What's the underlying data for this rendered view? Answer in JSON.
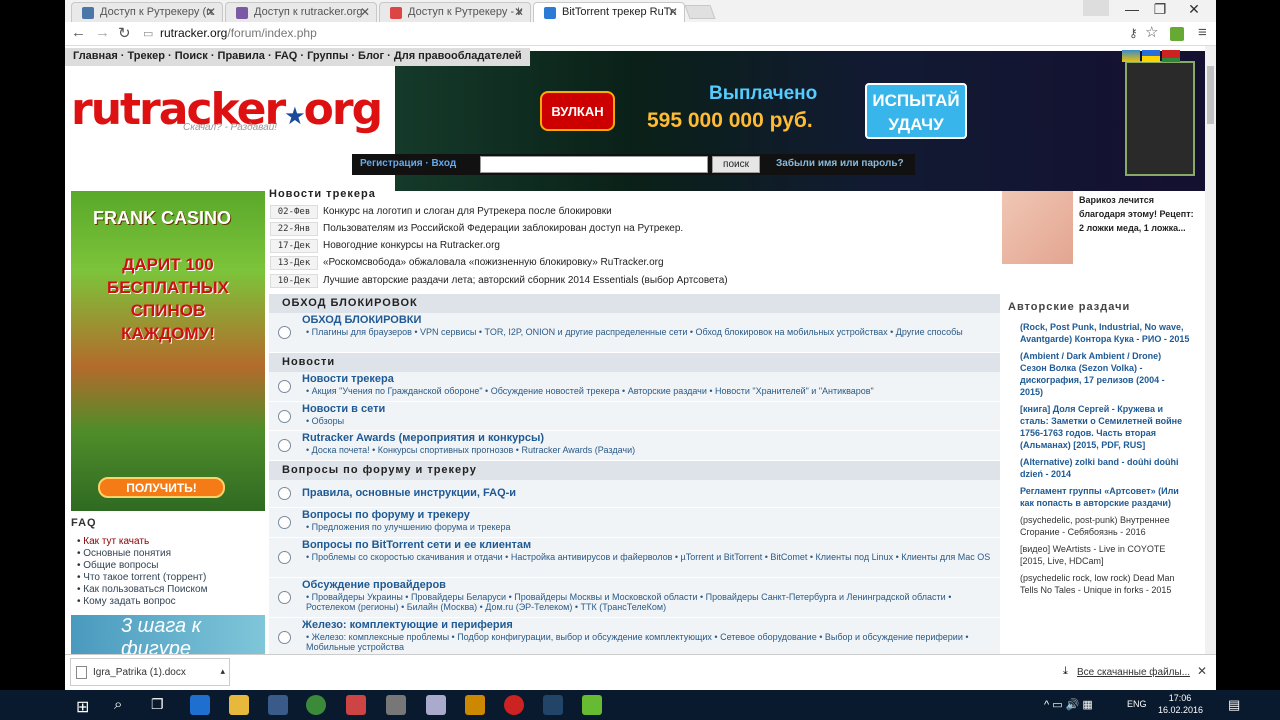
{
  "tabs": [
    {
      "label": "Доступ к Рутрекеру (rutra",
      "favcolor": "#4a76a8"
    },
    {
      "label": "Доступ к rutracker.org",
      "favcolor": "#7a5aa5"
    },
    {
      "label": "Доступ к Рутрекеру - Инт",
      "favcolor": "#d44"
    },
    {
      "label": "BitTorrent трекер RuTracke",
      "favcolor": "#2a7bd5"
    }
  ],
  "address": {
    "host": "rutracker.org",
    "path": "/forum/index.php"
  },
  "topnav": "Главная · Трекер · Поиск · Правила · FAQ · Группы · Блог · Для правообладателей",
  "logo": {
    "text": "rutracker",
    "dot": "★",
    "tld": "org",
    "tagline": "Скачал? - Раздавай!"
  },
  "ad": {
    "brand": "ВУЛКАН",
    "paid_label": "Выплачено",
    "paid_amount": "595 000 000 руб.",
    "cta": "ИСПЫТАЙ УДАЧУ"
  },
  "login": {
    "register": "Регистрация",
    "sep": "·",
    "login": "Вход",
    "search_btn": "поиск",
    "forgot": "Забыли имя или пароль?"
  },
  "casino": {
    "brand": "FRANK CASINO",
    "offer": "ДАРИТ 100 БЕСПЛАТНЫХ СПИНОВ КАЖДОМУ!",
    "button": "ПОЛУЧИТЬ!"
  },
  "faq": {
    "title": "FAQ",
    "items": [
      "Как тут качать",
      "Основные понятия",
      "Общие вопросы",
      "Что такое torrent (торрент)",
      "Как пользоваться Поиском",
      "Кому задать вопрос"
    ]
  },
  "steps_ad": "3 шага к фигуре",
  "news": {
    "title": "Новости трекера",
    "items": [
      {
        "date": "02-Фев",
        "text": "Конкурс на логотип и слоган для Рутрекера после блокировки"
      },
      {
        "date": "22-Янв",
        "text": "Пользователям из Российской Федерации заблокирован доступ на Рутрекер."
      },
      {
        "date": "17-Дек",
        "text": "Новогодние конкурсы на Rutracker.org"
      },
      {
        "date": "13-Дек",
        "text": "«Роскомсвобода» обжаловала «пожизненную блокировку» RuTracker.org"
      },
      {
        "date": "10-Дек",
        "text": "Лучшие авторские раздачи лета; авторский сборник 2014 Essentials (выбор Артсовета)"
      }
    ]
  },
  "forum": {
    "cats": [
      "ОБХОД БЛОКИРОВОК",
      "Новости",
      "Вопросы по форуму и трекеру"
    ],
    "rows": [
      {
        "title": "ОБХОД БЛОКИРОВКИ",
        "sub": "• Плагины для браузеров • VPN сервисы • TOR, I2P, ONION и другие распределенные сети • Обход блокировок на мобильных устройствах • Другие способы"
      },
      {
        "title": "Новости трекера",
        "sub": "• Акция \"Учения по Гражданской обороне\" • Обсуждение новостей трекера • Авторские раздачи • Новости \"Хранителей\" и \"Антикваров\""
      },
      {
        "title": "Новости в сети",
        "sub": "• Обзоры"
      },
      {
        "title": "Rutracker Awards (мероприятия и конкурсы)",
        "sub": "• Доска почета! • Конкурсы спортивных прогнозов • Rutracker Awards (Раздачи)"
      },
      {
        "title": "Правила, основные инструкции, FAQ-и",
        "sub": ""
      },
      {
        "title": "Вопросы по форуму и трекеру",
        "sub": "• Предложения по улучшению форума и трекера"
      },
      {
        "title": "Вопросы по BitTorrent сети и ее клиентам",
        "sub": "• Проблемы со скоростью скачивания и отдачи • Настройка антивирусов и файерволов • µTorrent и BitTorrent • BitComet • Клиенты под Linux • Клиенты для Mac OS"
      },
      {
        "title": "Обсуждение провайдеров",
        "sub": "• Провайдеры Украины • Провайдеры Беларуси • Провайдеры Москвы и Московской области • Провайдеры Санкт-Петербурга и Ленинградской области • Ростелеком (регионы) • Билайн (Москва) • Дом.ru (ЭР-Телеком) • ТТК (ТрансТелеКом)"
      },
      {
        "title": "Железо: комплектующие и периферия",
        "sub": "• Железо: комплексные проблемы • Подбор конфигурации, выбор и обсуждение комплектующих • Сетевое оборудование • Выбор и обсуждение периферии • Мобильные устройства"
      }
    ]
  },
  "right_ad": "Варикоз лечится благодаря этому! Рецепт: 2 ложки меда, 1 ложка...",
  "author": {
    "title": "Авторские раздачи",
    "items": [
      "(Rock, Post Punk, Industrial, No wave, Avantgarde) Контора Кука - РИО - 2015",
      "(Ambient / Dark Ambient / Drone) Сезон Волка (Sezon Volka) - дискография, 17 релизов (2004 - 2015)",
      "[книга] Доля Сергей - Кружева и сталь: Заметки о Семилетней войне 1756-1763 годов. Часть вторая (Альманах) [2015, PDF, RUS]",
      "(Alternative) zolki band - doûhi doûhi dzień - 2014",
      "Регламент группы «Артсовет» (Или как попасть в авторские раздачи)",
      "(psychedelic, post-punk) Внутреннее Сгорание - Себябоязнь - 2016",
      "[видео] WeArtists - Live in COYOTE [2015, Live, HDCam]",
      "(psychedelic rock, low rock) Dead Man Tells No Tales - Unique in forks - 2015"
    ]
  },
  "download": {
    "file": "Igra_Patrika (1).docx",
    "all": "Все скачанные файлы..."
  },
  "taskbar": {
    "lang": "ENG",
    "time": "17:06",
    "date": "16.02.2016"
  }
}
